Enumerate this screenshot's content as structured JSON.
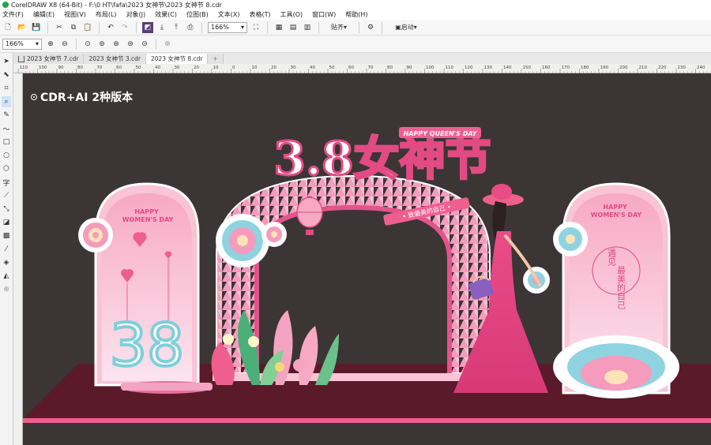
{
  "window": {
    "title": "CorelDRAW X8 (64-Bit) - F:\\0 HT\\fafa\\2023 女神节\\2023 女神节 8.cdr"
  },
  "menu": [
    "文件(F)",
    "编辑(E)",
    "视图(V)",
    "布局(L)",
    "对象(J)",
    "效果(C)",
    "位图(B)",
    "文本(X)",
    "表格(T)",
    "工具(O)",
    "窗口(W)",
    "帮助(H)"
  ],
  "toolbar": {
    "zoom": "166%",
    "snap_label": "贴齐",
    "launch_label": "启动"
  },
  "propbar": {
    "zoom": "166%"
  },
  "tabs": [
    "2023 女神节 7.cdr",
    "2023 女神节 3.cdr",
    "2023 女神节 8.cdr"
  ],
  "ruler": {
    "labels": [
      "110",
      "100",
      "90",
      "80",
      "70",
      "60",
      "50",
      "40",
      "30",
      "20",
      "10",
      "0",
      "10",
      "20",
      "30",
      "40",
      "50",
      "60",
      "70",
      "80",
      "90",
      "100",
      "110",
      "120",
      "130",
      "140",
      "150",
      "160",
      "170",
      "180",
      "190",
      "200",
      "210",
      "220",
      "230",
      "240"
    ]
  },
  "artwork": {
    "version_label": "CDR+AI 2种版本",
    "main_title": "3.8女神节",
    "title_en": "HAPPY QUEEN'S DAY",
    "ribbon": "• 致最美的自己 •",
    "left_panel_text": "HAPPY\nWOMEN'S DAY",
    "left_panel_big": "38",
    "right_panel_text": "HAPPY\nWOMEN'S DAY",
    "right_panel_vertical_1": "遇见",
    "right_panel_vertical_2": "最美的自己"
  },
  "colors": {
    "canvas_bg": "#3b3536",
    "floor": "#5a1a2a",
    "pink_main": "#ee5f8f",
    "pink_light": "#f9c4d6",
    "accent_blue": "#8fd3e0"
  }
}
